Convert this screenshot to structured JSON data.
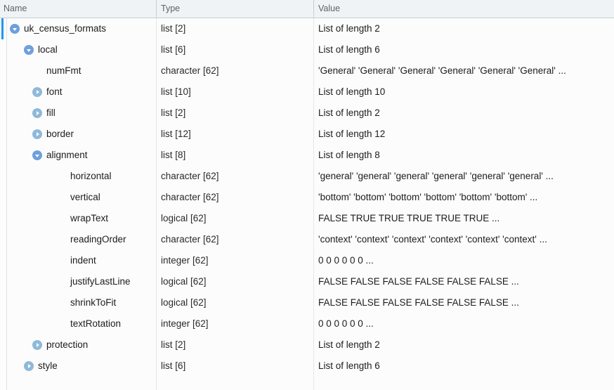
{
  "header": {
    "columns": [
      {
        "label": "Name"
      },
      {
        "label": "Type"
      },
      {
        "label": "Value"
      }
    ]
  },
  "rows": [
    {
      "name": "uk_census_formats",
      "type": "list [2]",
      "value": "List of length 2",
      "depth": 0,
      "toggle": "expanded",
      "selected": true
    },
    {
      "name": "local",
      "type": "list [6]",
      "value": "List of length 6",
      "depth": 1,
      "toggle": "expanded",
      "selected": false
    },
    {
      "name": "numFmt",
      "type": "character [62]",
      "value": "'General' 'General' 'General' 'General' 'General' 'General' ...",
      "depth": 2,
      "toggle": "none",
      "selected": false
    },
    {
      "name": "font",
      "type": "list [10]",
      "value": "List of length 10",
      "depth": 2,
      "toggle": "collapsed",
      "selected": false
    },
    {
      "name": "fill",
      "type": "list [2]",
      "value": "List of length 2",
      "depth": 2,
      "toggle": "collapsed",
      "selected": false
    },
    {
      "name": "border",
      "type": "list [12]",
      "value": "List of length 12",
      "depth": 2,
      "toggle": "collapsed",
      "selected": false
    },
    {
      "name": "alignment",
      "type": "list [8]",
      "value": "List of length 8",
      "depth": 2,
      "toggle": "expanded",
      "selected": false
    },
    {
      "name": "horizontal",
      "type": "character [62]",
      "value": "'general' 'general' 'general' 'general' 'general' 'general' ...",
      "depth": 3,
      "toggle": "none",
      "selected": false
    },
    {
      "name": "vertical",
      "type": "character [62]",
      "value": "'bottom' 'bottom' 'bottom' 'bottom' 'bottom' 'bottom' ...",
      "depth": 3,
      "toggle": "none",
      "selected": false
    },
    {
      "name": "wrapText",
      "type": "logical [62]",
      "value": "FALSE TRUE TRUE TRUE TRUE TRUE ...",
      "depth": 3,
      "toggle": "none",
      "selected": false
    },
    {
      "name": "readingOrder",
      "type": "character [62]",
      "value": "'context' 'context' 'context' 'context' 'context' 'context' ...",
      "depth": 3,
      "toggle": "none",
      "selected": false
    },
    {
      "name": "indent",
      "type": "integer [62]",
      "value": "0 0 0 0 0 0 ...",
      "depth": 3,
      "toggle": "none",
      "selected": false
    },
    {
      "name": "justifyLastLine",
      "type": "logical [62]",
      "value": "FALSE FALSE FALSE FALSE FALSE FALSE ...",
      "depth": 3,
      "toggle": "none",
      "selected": false
    },
    {
      "name": "shrinkToFit",
      "type": "logical [62]",
      "value": "FALSE FALSE FALSE FALSE FALSE FALSE ...",
      "depth": 3,
      "toggle": "none",
      "selected": false
    },
    {
      "name": "textRotation",
      "type": "integer [62]",
      "value": "0 0 0 0 0 0 ...",
      "depth": 3,
      "toggle": "none",
      "selected": false
    },
    {
      "name": "protection",
      "type": "list [2]",
      "value": "List of length 2",
      "depth": 2,
      "toggle": "collapsed",
      "selected": false
    },
    {
      "name": "style",
      "type": "list [6]",
      "value": "List of length 6",
      "depth": 1,
      "toggle": "collapsed",
      "selected": false
    }
  ],
  "colors": {
    "header_background": "#eff3f5",
    "header_text": "#5b6468",
    "selection_accent": "#2196f3",
    "toggle_expanded": "#6f9fdc",
    "toggle_collapsed": "#8fb9d9",
    "body_background": "#fcfcfc",
    "divider": "#c9ced1"
  }
}
